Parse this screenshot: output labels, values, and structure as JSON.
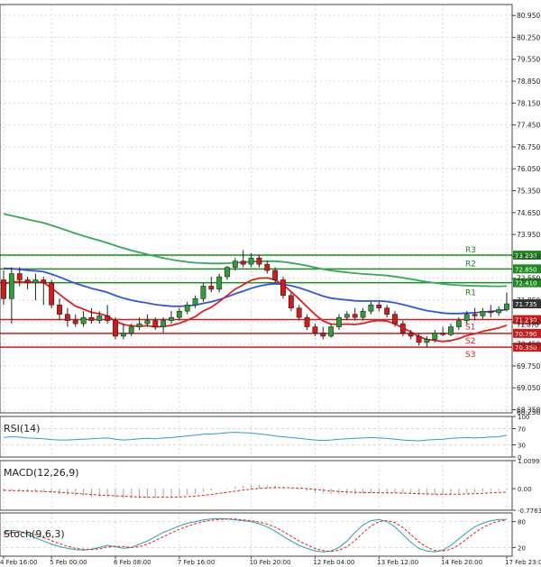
{
  "colors": {
    "grid": "#d6d6d6",
    "axis": "#444444",
    "bull": "#2f9e3a",
    "bear": "#d11a1a",
    "wick": "#222222",
    "ma_fast": "#e02020",
    "ma_mid": "#3355dd",
    "ma_slow": "#33aa55",
    "resistance": "#1f8a1f",
    "support": "#d11a1a",
    "rsi": "#3399cc",
    "macd_hist": "#a8a8a8",
    "macd_signal": "#e02020",
    "stoch_k": "#2aa0b0",
    "stoch_d": "#e02020",
    "last_price_bg": "#333333",
    "text": "#222222"
  },
  "chart_data": {
    "type": "candlestick",
    "price_axis": {
      "range": [
        68.25,
        81.3
      ],
      "ticks": [
        "80.950",
        "80.250",
        "79.550",
        "78.850",
        "78.150",
        "77.450",
        "76.750",
        "76.050",
        "75.350",
        "74.650",
        "73.950",
        "73.250",
        "72.550",
        "71.850",
        "71.150",
        "70.450",
        "69.750",
        "69.050",
        "68.350"
      ],
      "tick_values": [
        80.95,
        80.25,
        79.55,
        78.85,
        78.15,
        77.45,
        76.75,
        76.05,
        75.35,
        74.65,
        73.95,
        73.25,
        72.55,
        71.85,
        71.15,
        70.45,
        69.75,
        69.05,
        68.35
      ],
      "bottom_label": "68.250"
    },
    "time_axis": {
      "labels": [
        "4 Feb 16:00",
        "5 Feb 00:00",
        "6 Feb 08:00",
        "7 Feb 16:00",
        "10 Feb 20:00",
        "12 Feb 04:00",
        "13 Feb 12:00",
        "14 Feb 20:00",
        "17 Feb 23:01"
      ],
      "label_bar_index": [
        0,
        6,
        14,
        22,
        31,
        39,
        47,
        55,
        63
      ]
    },
    "candles": [
      [
        72.5,
        72.8,
        71.7,
        71.9
      ],
      [
        71.9,
        72.9,
        71.1,
        72.7
      ],
      [
        72.7,
        72.9,
        72.3,
        72.5
      ],
      [
        72.5,
        72.6,
        72.2,
        72.4
      ],
      [
        72.4,
        72.7,
        71.85,
        72.5
      ],
      [
        72.5,
        72.6,
        71.7,
        72.4
      ],
      [
        72.4,
        72.5,
        71.6,
        71.7
      ],
      [
        71.7,
        71.9,
        71.2,
        71.4
      ],
      [
        71.4,
        71.6,
        71.0,
        71.2
      ],
      [
        71.2,
        71.4,
        71.0,
        71.1
      ],
      [
        71.1,
        71.5,
        71.0,
        71.3
      ],
      [
        71.3,
        71.6,
        71.1,
        71.2
      ],
      [
        71.2,
        71.5,
        71.1,
        71.35
      ],
      [
        71.35,
        71.7,
        71.1,
        71.2
      ],
      [
        71.2,
        71.3,
        70.6,
        70.7
      ],
      [
        70.7,
        71.1,
        70.6,
        70.8
      ],
      [
        70.8,
        71.1,
        70.7,
        71.0
      ],
      [
        71.0,
        71.3,
        70.9,
        71.1
      ],
      [
        71.1,
        71.4,
        71.0,
        71.2
      ],
      [
        71.2,
        71.3,
        70.9,
        71.0
      ],
      [
        71.0,
        71.3,
        70.8,
        71.2
      ],
      [
        71.2,
        71.5,
        71.1,
        71.3
      ],
      [
        71.3,
        71.6,
        71.2,
        71.5
      ],
      [
        71.5,
        71.8,
        71.4,
        71.7
      ],
      [
        71.7,
        72.0,
        71.6,
        71.9
      ],
      [
        71.9,
        72.4,
        71.8,
        72.3
      ],
      [
        72.3,
        72.6,
        72.1,
        72.2
      ],
      [
        72.2,
        72.7,
        72.1,
        72.6
      ],
      [
        72.6,
        72.95,
        72.5,
        72.9
      ],
      [
        72.9,
        73.2,
        72.8,
        73.1
      ],
      [
        73.1,
        73.45,
        72.9,
        73.0
      ],
      [
        73.0,
        73.35,
        72.9,
        73.2
      ],
      [
        73.2,
        73.3,
        72.9,
        73.0
      ],
      [
        73.0,
        73.1,
        72.7,
        72.8
      ],
      [
        72.8,
        72.9,
        72.4,
        72.5
      ],
      [
        72.5,
        72.6,
        71.9,
        72.0
      ],
      [
        72.0,
        72.1,
        71.5,
        71.6
      ],
      [
        71.6,
        71.7,
        71.2,
        71.3
      ],
      [
        71.3,
        71.4,
        70.9,
        71.0
      ],
      [
        71.0,
        71.1,
        70.7,
        70.8
      ],
      [
        70.8,
        71.0,
        70.6,
        70.7
      ],
      [
        70.7,
        71.1,
        70.65,
        71.0
      ],
      [
        71.0,
        71.4,
        70.9,
        71.3
      ],
      [
        71.3,
        71.5,
        71.2,
        71.4
      ],
      [
        71.4,
        71.6,
        71.2,
        71.3
      ],
      [
        71.3,
        71.6,
        71.2,
        71.5
      ],
      [
        71.5,
        71.8,
        71.4,
        71.7
      ],
      [
        71.7,
        71.8,
        71.5,
        71.6
      ],
      [
        71.6,
        71.7,
        71.3,
        71.4
      ],
      [
        71.4,
        71.5,
        71.0,
        71.1
      ],
      [
        71.1,
        71.2,
        70.7,
        70.8
      ],
      [
        70.8,
        70.9,
        70.6,
        70.7
      ],
      [
        70.7,
        70.8,
        70.4,
        70.5
      ],
      [
        70.5,
        70.7,
        70.35,
        70.6
      ],
      [
        70.6,
        70.9,
        70.5,
        70.8
      ],
      [
        70.8,
        71.0,
        70.7,
        70.75
      ],
      [
        70.75,
        71.1,
        70.7,
        71.0
      ],
      [
        71.0,
        71.3,
        70.9,
        71.2
      ],
      [
        71.2,
        71.5,
        71.1,
        71.4
      ],
      [
        71.4,
        71.6,
        71.2,
        71.35
      ],
      [
        71.35,
        71.6,
        71.25,
        71.5
      ],
      [
        71.5,
        71.7,
        71.3,
        71.45
      ],
      [
        71.45,
        71.65,
        71.35,
        71.55
      ],
      [
        71.55,
        72.1,
        71.5,
        71.735
      ]
    ],
    "moving_averages": [
      {
        "values_from": 74.7,
        "values_to": 72.3
      },
      {
        "values_from": 72.95,
        "values_to": 71.55
      },
      {
        "values_from": 72.5,
        "values_to": 71.05
      }
    ],
    "levels": [
      {
        "name": "R3",
        "value": 73.29,
        "label": "73.290",
        "kind": "resistance"
      },
      {
        "name": "R2",
        "value": 72.85,
        "label": "72.850",
        "kind": "resistance"
      },
      {
        "name": "R1",
        "value": 72.41,
        "label": "72.410",
        "kind": "resistance"
      },
      {
        "name": "S1",
        "value": 71.23,
        "label": "71.230",
        "kind": "support"
      },
      {
        "name": "S2",
        "value": 70.79,
        "label": "70.790",
        "kind": "support"
      },
      {
        "name": "S3",
        "value": 70.35,
        "label": "70.350",
        "kind": "support"
      }
    ],
    "last_price": {
      "value": 71.735,
      "label": "71.735"
    },
    "overlap_label": "71.070",
    "grid": true,
    "indicators": [
      {
        "name": "RSI(14)",
        "range": [
          0,
          100
        ],
        "ticks": [
          "100",
          "70",
          "30",
          "0"
        ],
        "tick_values": [
          100,
          70,
          30,
          0
        ],
        "values": [
          48,
          50,
          49,
          47,
          46,
          45,
          43,
          42,
          42,
          43,
          44,
          45,
          46,
          47,
          44,
          42,
          43,
          45,
          46,
          45,
          47,
          48,
          50,
          52,
          54,
          56,
          57,
          58,
          60,
          61,
          60,
          59,
          57,
          55,
          52,
          50,
          48,
          46,
          44,
          42,
          41,
          42,
          44,
          45,
          46,
          47,
          48,
          47,
          46,
          44,
          42,
          41,
          40,
          42,
          43,
          44,
          46,
          47,
          48,
          47,
          48,
          49,
          50,
          54
        ]
      },
      {
        "name": "MACD(12,26,9)",
        "range": [
          -0.7763,
          1.0099
        ],
        "ticks": [
          "1.0099",
          "0.00",
          "-0.7763"
        ],
        "tick_values": [
          1.0099,
          0,
          -0.7763
        ],
        "histogram": [
          -0.1,
          -0.09,
          -0.1,
          -0.11,
          -0.12,
          -0.13,
          -0.16,
          -0.2,
          -0.23,
          -0.26,
          -0.27,
          -0.29,
          -0.3,
          -0.31,
          -0.33,
          -0.35,
          -0.35,
          -0.35,
          -0.34,
          -0.33,
          -0.32,
          -0.3,
          -0.27,
          -0.23,
          -0.18,
          -0.12,
          -0.07,
          -0.02,
          0.03,
          0.08,
          0.11,
          0.13,
          0.14,
          0.13,
          0.11,
          0.07,
          0.02,
          -0.03,
          -0.08,
          -0.13,
          -0.17,
          -0.19,
          -0.2,
          -0.2,
          -0.19,
          -0.18,
          -0.16,
          -0.15,
          -0.15,
          -0.16,
          -0.18,
          -0.2,
          -0.22,
          -0.23,
          -0.23,
          -0.22,
          -0.2,
          -0.18,
          -0.15,
          -0.13,
          -0.11,
          -0.09,
          -0.08,
          -0.05
        ],
        "signal": [
          -0.06,
          -0.07,
          -0.07,
          -0.08,
          -0.09,
          -0.1,
          -0.11,
          -0.13,
          -0.15,
          -0.17,
          -0.19,
          -0.21,
          -0.23,
          -0.24,
          -0.26,
          -0.27,
          -0.29,
          -0.3,
          -0.31,
          -0.31,
          -0.31,
          -0.31,
          -0.3,
          -0.29,
          -0.27,
          -0.24,
          -0.21,
          -0.17,
          -0.13,
          -0.09,
          -0.05,
          -0.02,
          0.01,
          0.03,
          0.04,
          0.04,
          0.03,
          0.02,
          0.0,
          -0.03,
          -0.06,
          -0.08,
          -0.1,
          -0.12,
          -0.13,
          -0.14,
          -0.14,
          -0.15,
          -0.15,
          -0.15,
          -0.16,
          -0.17,
          -0.18,
          -0.19,
          -0.2,
          -0.2,
          -0.2,
          -0.2,
          -0.19,
          -0.18,
          -0.17,
          -0.15,
          -0.14,
          -0.12
        ]
      },
      {
        "name": "Stoch(9,6,3)",
        "range": [
          0,
          100
        ],
        "ticks": [
          "80",
          "20"
        ],
        "tick_values": [
          80,
          20
        ],
        "k": [
          55,
          60,
          58,
          50,
          42,
          35,
          28,
          22,
          18,
          15,
          14,
          16,
          20,
          25,
          22,
          18,
          20,
          28,
          35,
          45,
          55,
          62,
          70,
          76,
          80,
          84,
          86,
          87,
          86,
          84,
          82,
          80,
          75,
          68,
          58,
          46,
          35,
          25,
          18,
          12,
          10,
          12,
          20,
          35,
          55,
          72,
          82,
          85,
          80,
          68,
          50,
          32,
          18,
          12,
          10,
          14,
          25,
          40,
          55,
          68,
          76,
          82,
          85,
          85
        ],
        "d": [
          50,
          54,
          56,
          55,
          50,
          43,
          36,
          29,
          23,
          18,
          16,
          15,
          17,
          21,
          23,
          22,
          20,
          22,
          28,
          36,
          45,
          54,
          62,
          69,
          75,
          80,
          83,
          85,
          86,
          86,
          84,
          82,
          79,
          74,
          67,
          57,
          46,
          35,
          26,
          18,
          13,
          11,
          14,
          22,
          36,
          54,
          70,
          80,
          82,
          78,
          66,
          50,
          33,
          21,
          13,
          12,
          16,
          26,
          40,
          54,
          66,
          75,
          81,
          84
        ]
      }
    ]
  }
}
